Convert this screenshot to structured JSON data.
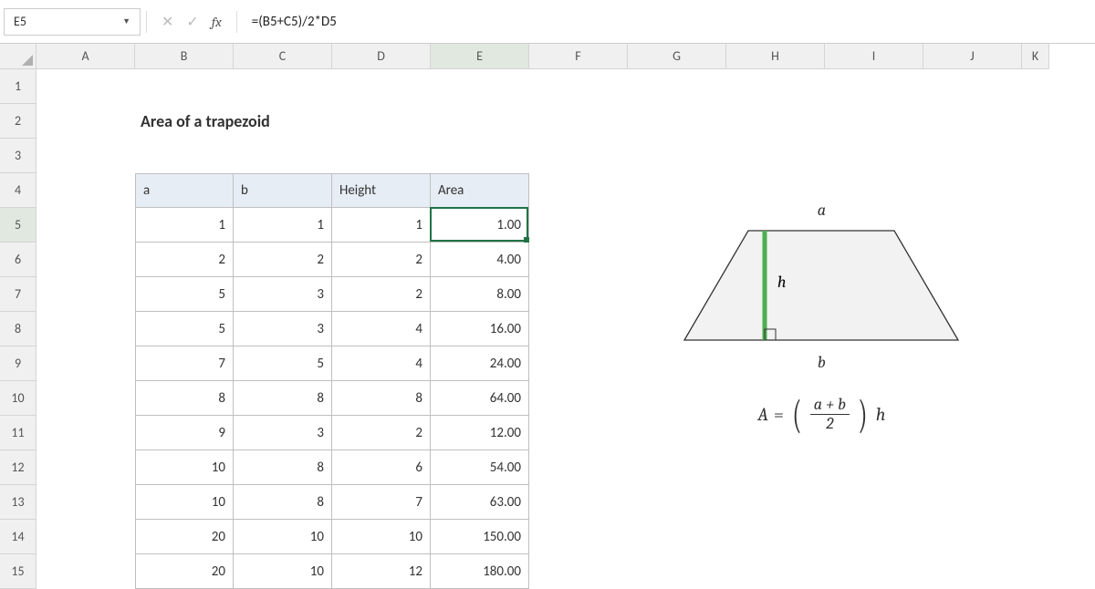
{
  "name_box": {
    "value": "E5"
  },
  "formula_bar": {
    "formula": "=(B5+C5)/2*D5",
    "fx_label": "fx"
  },
  "columns": [
    "A",
    "B",
    "C",
    "D",
    "E",
    "F",
    "G",
    "H",
    "I",
    "J",
    "K"
  ],
  "rows": [
    "1",
    "2",
    "3",
    "4",
    "5",
    "6",
    "7",
    "8",
    "9",
    "10",
    "11",
    "12",
    "13",
    "14",
    "15"
  ],
  "title": "Area of a trapezoid",
  "table": {
    "headers": {
      "a": "a",
      "b": "b",
      "height": "Height",
      "area": "Area"
    },
    "rows": [
      {
        "a": "1",
        "b": "1",
        "h": "1",
        "area": "1.00"
      },
      {
        "a": "2",
        "b": "2",
        "h": "2",
        "area": "4.00"
      },
      {
        "a": "5",
        "b": "3",
        "h": "2",
        "area": "8.00"
      },
      {
        "a": "5",
        "b": "3",
        "h": "4",
        "area": "16.00"
      },
      {
        "a": "7",
        "b": "5",
        "h": "4",
        "area": "24.00"
      },
      {
        "a": "8",
        "b": "8",
        "h": "8",
        "area": "64.00"
      },
      {
        "a": "9",
        "b": "3",
        "h": "2",
        "area": "12.00"
      },
      {
        "a": "10",
        "b": "8",
        "h": "6",
        "area": "54.00"
      },
      {
        "a": "10",
        "b": "8",
        "h": "7",
        "area": "63.00"
      },
      {
        "a": "20",
        "b": "10",
        "h": "10",
        "area": "150.00"
      },
      {
        "a": "20",
        "b": "10",
        "h": "12",
        "area": "180.00"
      }
    ]
  },
  "diagram": {
    "top_label": "a",
    "bottom_label": "b",
    "height_label": "h"
  },
  "math": {
    "lhs": "A",
    "eq": " = ",
    "num": "a + b",
    "den": "2",
    "rhs": "h"
  }
}
